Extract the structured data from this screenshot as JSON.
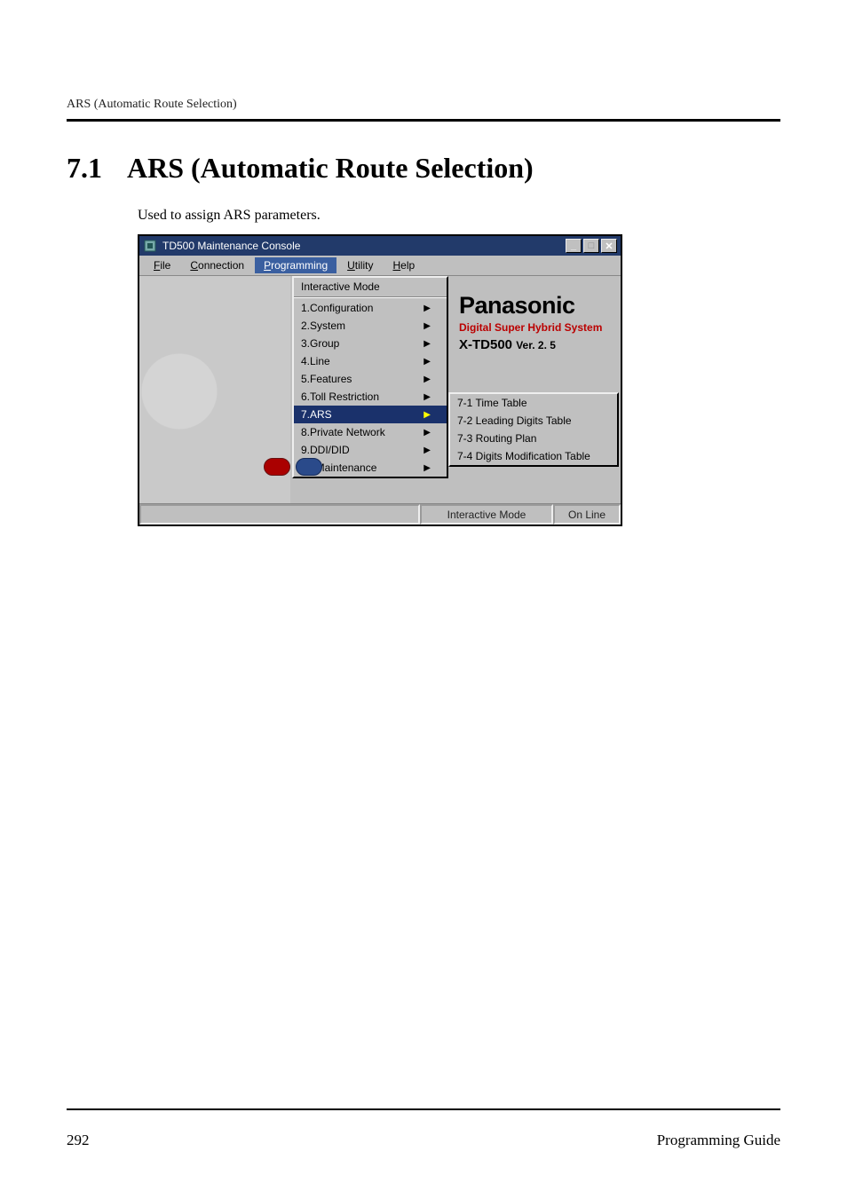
{
  "header": {
    "running_head": "ARS (Automatic Route Selection)"
  },
  "section": {
    "number": "7.1",
    "title": "ARS (Automatic Route Selection)",
    "intro": "Used to assign ARS parameters."
  },
  "window": {
    "title": "TD500 Maintenance Console",
    "menubar": {
      "file": "File",
      "connection": "Connection",
      "programming": "Programming",
      "utility": "Utility",
      "help": "Help"
    },
    "dropdown": {
      "top_label": "Interactive Mode",
      "items": [
        {
          "label": "1.Configuration",
          "has_sub": true
        },
        {
          "label": "2.System",
          "has_sub": true
        },
        {
          "label": "3.Group",
          "has_sub": true
        },
        {
          "label": "4.Line",
          "has_sub": true
        },
        {
          "label": "5.Features",
          "has_sub": true
        },
        {
          "label": "6.Toll Restriction",
          "has_sub": true
        },
        {
          "label": "7.ARS",
          "has_sub": true,
          "highlight": true
        },
        {
          "label": "8.Private Network",
          "has_sub": true
        },
        {
          "label": "9.DDI/DID",
          "has_sub": true
        },
        {
          "label": "10.Maintenance",
          "has_sub": true
        }
      ]
    },
    "submenu": [
      {
        "label": "7-1 Time Table"
      },
      {
        "label": "7-2 Leading Digits Table"
      },
      {
        "label": "7-3 Routing Plan"
      },
      {
        "label": "7-4 Digits Modification Table"
      }
    ],
    "branding": {
      "name": "Panasonic",
      "line1": "Digital Super Hybrid System",
      "model": "X-TD500",
      "version": "Ver. 2. 5"
    },
    "statusbar": {
      "mode": "Interactive Mode",
      "conn": "On Line"
    }
  },
  "footer": {
    "page": "292",
    "doc": "Programming Guide"
  }
}
